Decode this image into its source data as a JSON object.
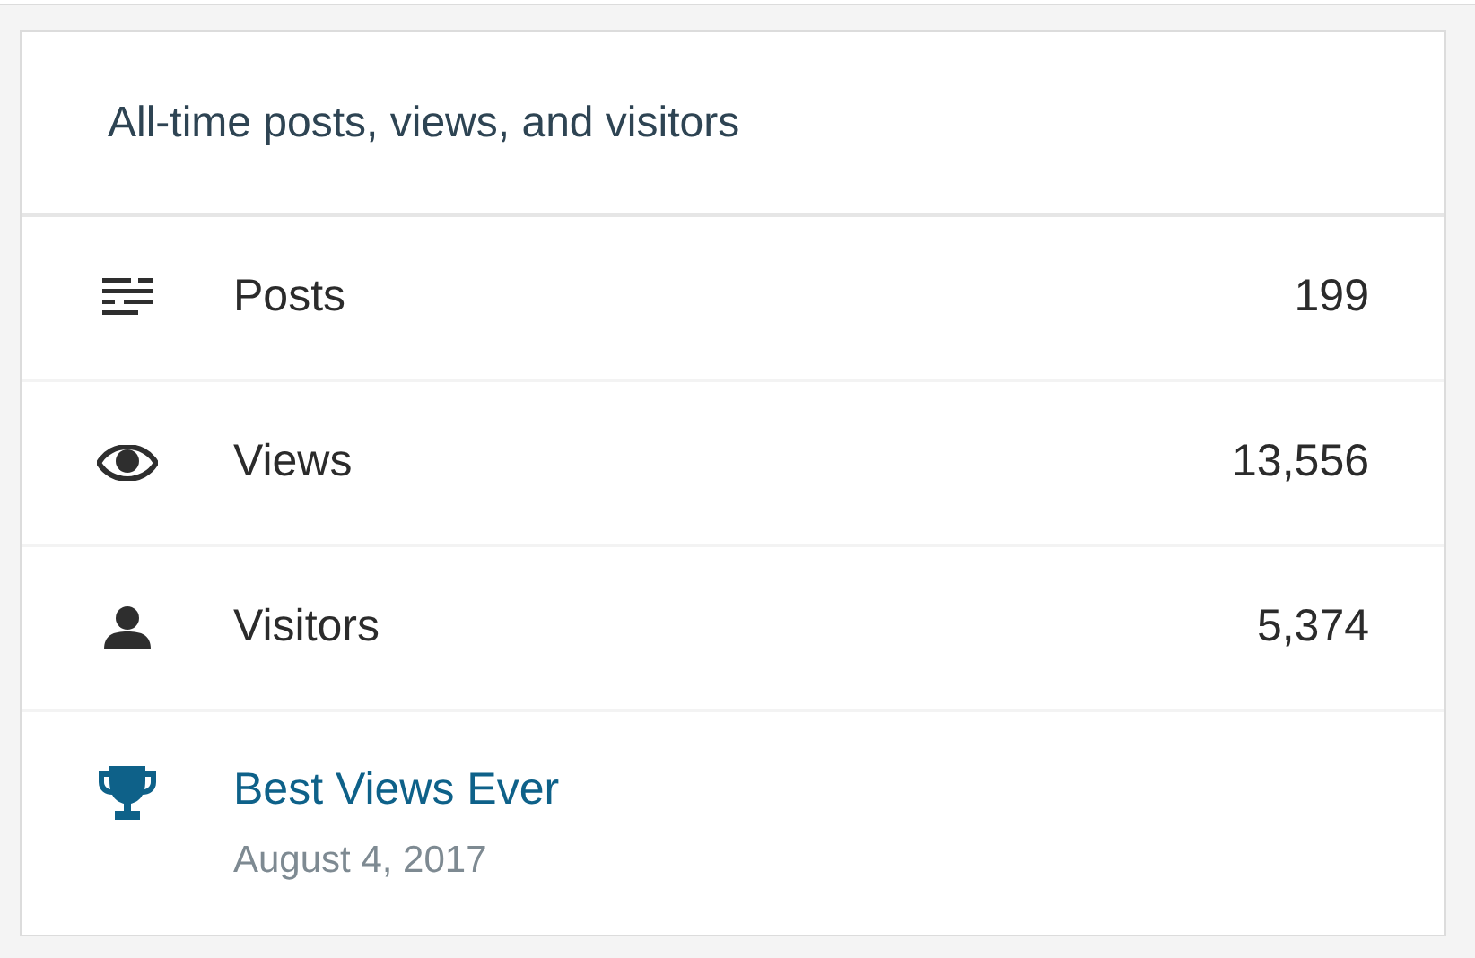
{
  "card": {
    "title": "All-time posts, views, and visitors",
    "stats": [
      {
        "kind": "posts",
        "label": "Posts",
        "value": "199"
      },
      {
        "kind": "views",
        "label": "Views",
        "value": "13,556"
      },
      {
        "kind": "visitors",
        "label": "Visitors",
        "value": "5,374"
      }
    ],
    "best": {
      "kind": "trophy",
      "link": "Best Views Ever",
      "date": "August 4, 2017"
    }
  }
}
